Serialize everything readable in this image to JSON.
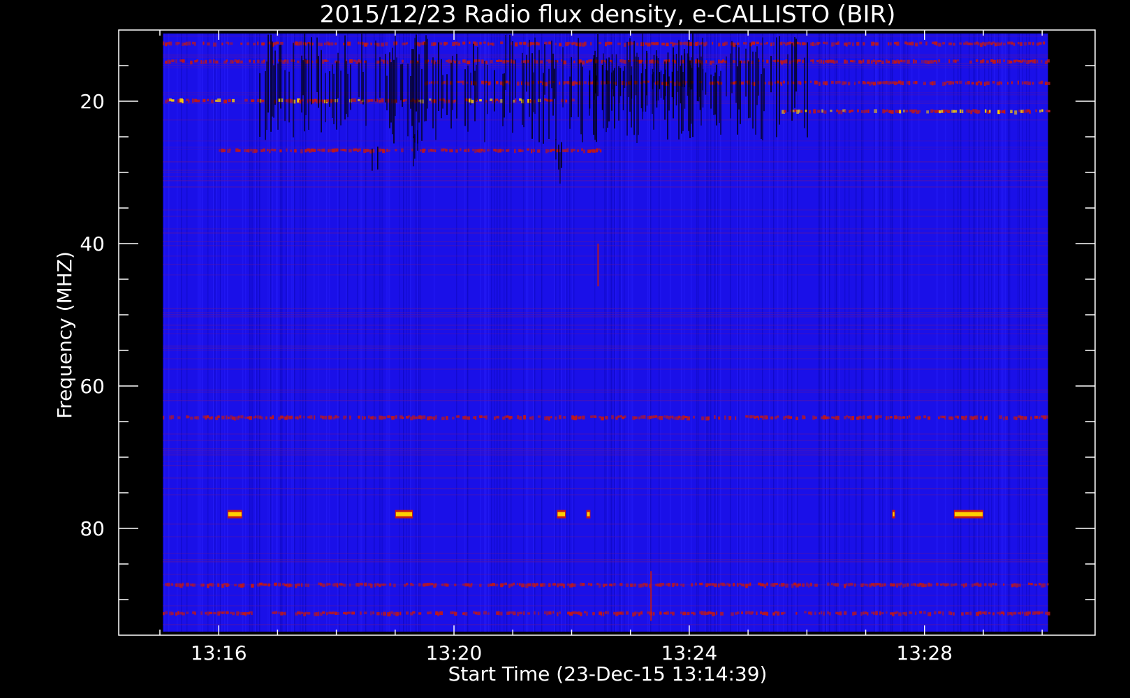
{
  "chart_data": {
    "type": "heatmap",
    "title": "2015/12/23  Radio flux density, e-CALLISTO (BIR)",
    "xlabel": "Start Time (23-Dec-15 13:14:39)",
    "ylabel": "Frequency (MHZ)",
    "x_ticks": [
      "13:16",
      "13:20",
      "13:24",
      "13:28"
    ],
    "x_tick_minutes": [
      16,
      20,
      24,
      28
    ],
    "x_range_minutes": [
      14.3,
      30.9
    ],
    "data_extent_minutes": [
      15.05,
      30.1
    ],
    "y_ticks": [
      20,
      40,
      60,
      80
    ],
    "y_range": [
      10,
      95
    ],
    "y_inverted": true,
    "data_extent_mhz": [
      10.5,
      94.5
    ],
    "grid": false,
    "colors": {
      "background": "#000000",
      "low": "#1a10e8",
      "mid": "#c01818",
      "high": "#ffd000"
    },
    "features": [
      {
        "kind": "band",
        "mhz": 12.0,
        "t0": 15.05,
        "t1": 30.1,
        "level": "mid"
      },
      {
        "kind": "band",
        "mhz": 14.5,
        "t0": 15.05,
        "t1": 30.1,
        "level": "mid"
      },
      {
        "kind": "band",
        "mhz": 17.5,
        "t0": 19.5,
        "t1": 30.1,
        "level": "mid"
      },
      {
        "kind": "band",
        "mhz": 20.0,
        "t0": 15.05,
        "t1": 22.0,
        "level": "high"
      },
      {
        "kind": "band",
        "mhz": 21.5,
        "t0": 25.5,
        "t1": 30.1,
        "level": "high"
      },
      {
        "kind": "band",
        "mhz": 27.0,
        "t0": 16.0,
        "t1": 22.5,
        "level": "mid"
      },
      {
        "kind": "dark",
        "mhz0": 10.5,
        "mhz1": 26.0,
        "t0": 16.5,
        "t1": 26.0
      },
      {
        "kind": "dark",
        "mhz0": 13.0,
        "mhz1": 21.5,
        "t0": 22.3,
        "t1": 24.3
      },
      {
        "kind": "dark",
        "mhz0": 24.0,
        "mhz1": 32.0,
        "t0": 21.7,
        "t1": 22.0
      },
      {
        "kind": "dark",
        "mhz0": 24.0,
        "mhz1": 31.0,
        "t0": 19.3,
        "t1": 19.5
      },
      {
        "kind": "dark",
        "mhz0": 26.0,
        "mhz1": 31.0,
        "t0": 18.6,
        "t1": 18.8
      },
      {
        "kind": "band",
        "mhz": 64.5,
        "t0": 15.05,
        "t1": 30.1,
        "level": "mid"
      },
      {
        "kind": "band",
        "mhz": 88.0,
        "t0": 15.05,
        "t1": 30.1,
        "level": "mid"
      },
      {
        "kind": "band",
        "mhz": 92.0,
        "t0": 15.05,
        "t1": 30.1,
        "level": "mid"
      },
      {
        "kind": "burst",
        "mhz": 78.0,
        "t0": 16.15,
        "t1": 16.4
      },
      {
        "kind": "burst",
        "mhz": 78.0,
        "t0": 19.0,
        "t1": 19.3
      },
      {
        "kind": "burst",
        "mhz": 78.0,
        "t0": 21.75,
        "t1": 21.9
      },
      {
        "kind": "burst",
        "mhz": 78.0,
        "t0": 22.25,
        "t1": 22.32
      },
      {
        "kind": "burst",
        "mhz": 78.0,
        "t0": 27.45,
        "t1": 27.5
      },
      {
        "kind": "burst",
        "mhz": 78.0,
        "t0": 28.5,
        "t1": 29.0
      },
      {
        "kind": "spike",
        "mhz0": 40.0,
        "mhz1": 46.0,
        "t": 22.45
      },
      {
        "kind": "spike",
        "mhz0": 86.0,
        "mhz1": 93.0,
        "t": 23.35
      }
    ]
  }
}
